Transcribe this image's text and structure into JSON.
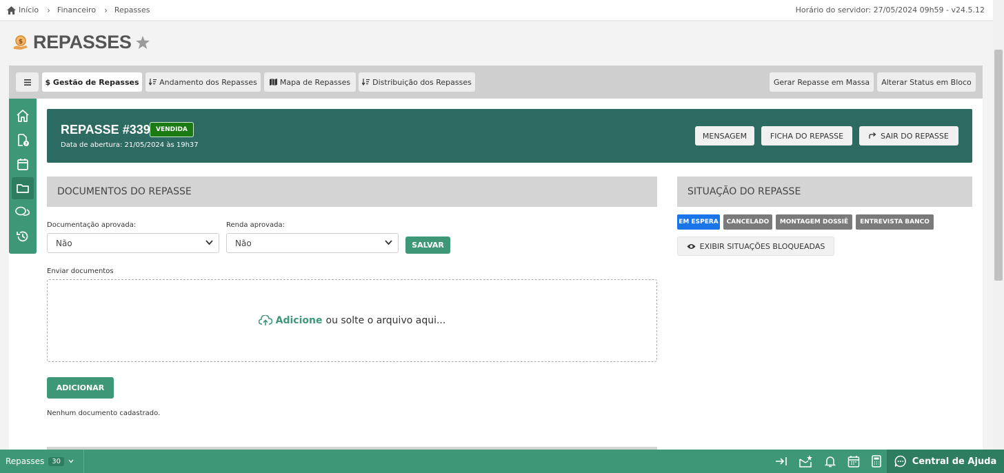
{
  "breadcrumb": {
    "items": [
      "Início",
      "Financeiro",
      "Repasses"
    ],
    "server_time": "Horário do servidor: 27/05/2024 09h59 - v24.5.12"
  },
  "page": {
    "title": "REPASSES"
  },
  "toolbar": {
    "tabs": [
      {
        "label": "$ Gestão de Repasses",
        "active": true
      },
      {
        "label": "Andamento dos Repasses"
      },
      {
        "label": "Mapa de Repasses"
      },
      {
        "label": "Distribuição dos Repasses"
      }
    ],
    "actions": [
      "Gerar Repasse em Massa",
      "Alterar Status em Bloco"
    ]
  },
  "rail": {
    "items": [
      "home",
      "file-info",
      "calendar",
      "folder",
      "chat",
      "history"
    ],
    "active_index": 3
  },
  "banner": {
    "title": "REPASSE #339",
    "status": "VENDIDA",
    "opened": "Data de abertura: 21/05/2024 às 19h37",
    "buttons": {
      "message": "MENSAGEM",
      "sheet": "FICHA DO REPASSE",
      "exit": "SAIR DO REPASSE"
    }
  },
  "documents": {
    "heading": "DOCUMENTOS DO REPASSE",
    "doc_approved_label": "Documentação aprovada:",
    "doc_approved_value": "Não",
    "income_approved_label": "Renda aprovada:",
    "income_approved_value": "Não",
    "save_label": "SALVAR",
    "upload_label": "Enviar documentos",
    "dropzone_strong": "Adicione",
    "dropzone_rest": "ou solte o arquivo aqui...",
    "add_label": "ADICIONAR",
    "empty_text": "Nenhum documento cadastrado."
  },
  "situation": {
    "heading": "SITUAÇÃO DO REPASSE",
    "badges": [
      "EM ESPERA",
      "CANCELADO",
      "MONTAGEM DOSSIÊ",
      "ENTREVISTA BANCO"
    ],
    "show_blocked": "EXIBIR SITUAÇÕES BLOQUEADAS"
  },
  "bottombar": {
    "module": "Repasses",
    "count": "30",
    "help": "Central de Ajuda"
  },
  "colors": {
    "accent": "#3e9878",
    "banner": "#2d6b62",
    "status_green": "#1a7a14",
    "badge_blue": "#1a75e8",
    "badge_grey": "#7a7a7a"
  }
}
